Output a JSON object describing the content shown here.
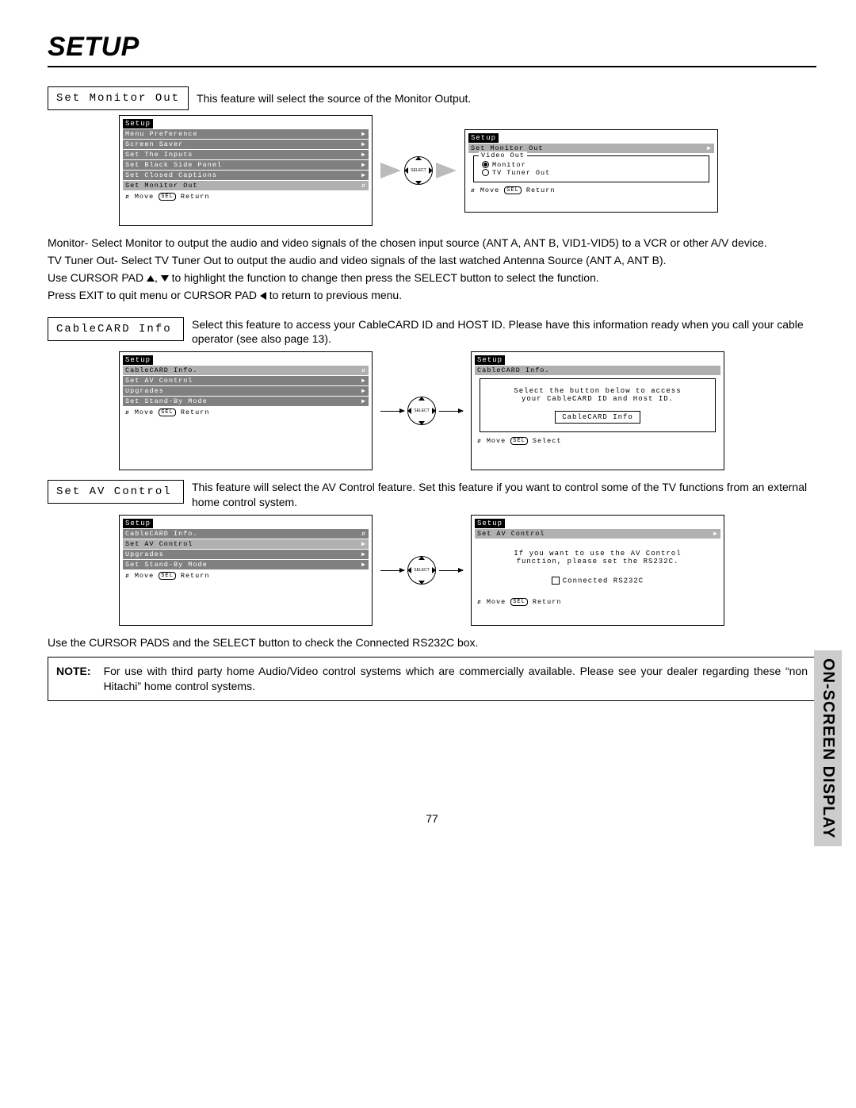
{
  "page_title": "SETUP",
  "side_tab": "ON-SCREEN DISPLAY",
  "page_number": "77",
  "sec1": {
    "label": "Set Monitor Out",
    "desc": "This feature will select the source of the Monitor Output.",
    "menu_left_title": "Setup",
    "menu_left_items": [
      "Menu Preference",
      "Screen Saver",
      "Set The Inputs",
      "Set Black Side Panel",
      "Set Closed Captions",
      "Set Monitor Out"
    ],
    "menu_left_foot_move": "Move",
    "menu_left_foot_return": "Return",
    "menu_right_title": "Setup",
    "menu_right_header": "Set Monitor Out",
    "menu_right_legend": "Video Out",
    "menu_right_opt1": "Monitor",
    "menu_right_opt2": "TV Tuner Out",
    "menu_right_foot_move": "Move",
    "menu_right_foot_return": "Return",
    "body_p1": "Monitor- Select Monitor to output the audio and video signals of the chosen input source (ANT A, ANT B, VID1-VID5) to a VCR or other A/V device.",
    "body_p2": "TV Tuner Out- Select TV Tuner Out to output the audio and video signals of the last watched Antenna Source (ANT A, ANT B).",
    "body_p3a": "Use CURSOR PAD ",
    "body_p3b": ", ",
    "body_p3c": " to highlight the function to change then press the SELECT button to select the function.",
    "body_p4a": "Press EXIT to quit menu or CURSOR PAD ",
    "body_p4b": " to return to previous menu."
  },
  "sec2": {
    "label": "CableCARD Info",
    "desc": "Select this feature to access your CableCARD ID and HOST ID.  Please have this information ready when you call your cable operator (see also page 13).",
    "menu_left_title": "Setup",
    "menu_left_items": [
      "CableCARD Info.",
      "Set AV Control",
      "Upgrades",
      "Set Stand-By Mode"
    ],
    "menu_left_foot_move": "Move",
    "menu_left_foot_return": "Return",
    "menu_right_title": "Setup",
    "menu_right_header": "CableCARD Info.",
    "sub_line1": "Select the button below to access",
    "sub_line2": "your CableCARD ID and Host ID.",
    "sub_button": "CableCARD Info",
    "menu_right_foot_move": "Move",
    "menu_right_foot_select": "Select"
  },
  "sec3": {
    "label": "Set AV Control",
    "desc": "This feature will select the AV Control feature.  Set this feature if you want to control some of the TV functions from an external home control system.",
    "menu_left_title": "Setup",
    "menu_left_items": [
      "CableCARD Info.",
      "Set AV Control",
      "Upgrades",
      "Set Stand-By Mode"
    ],
    "menu_left_foot_move": "Move",
    "menu_left_foot_return": "Return",
    "menu_right_title": "Setup",
    "menu_right_header": "Set AV Control",
    "sub_line1": "If you want to use the AV Control",
    "sub_line2": "function, please set the RS232C.",
    "sub_check": "Connected RS232C",
    "menu_right_foot_move": "Move",
    "menu_right_foot_return": "Return",
    "body_p1": "Use the CURSOR PADS and the SELECT button to check the Connected RS232C box."
  },
  "note": {
    "label": "NOTE:",
    "text": "For use with third party home Audio/Video control systems which are commercially available.  Please see your dealer regarding these “non Hitachi” home control systems."
  },
  "sel_badge": "SEL"
}
